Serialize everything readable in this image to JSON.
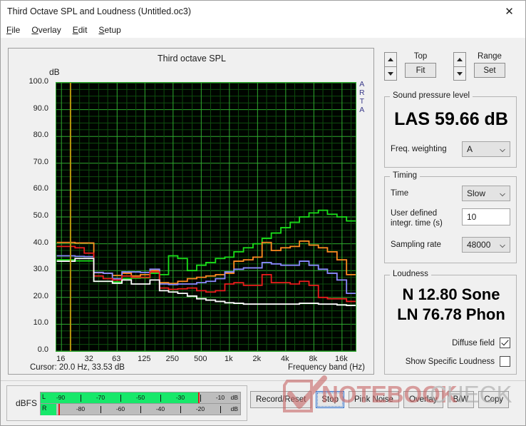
{
  "window": {
    "title": "Third Octave SPL and Loudness (Untitled.oc3)",
    "close_icon": "close-icon"
  },
  "menubar": {
    "items": [
      {
        "label": "File",
        "accel": "F"
      },
      {
        "label": "Overlay",
        "accel": "O"
      },
      {
        "label": "Edit",
        "accel": "E"
      },
      {
        "label": "Setup",
        "accel": "S"
      }
    ]
  },
  "graph": {
    "title": "Third octave SPL",
    "y_unit": "dB",
    "watermark_label": "ARTA",
    "cursor_text": "Cursor:   20.0 Hz, 33.53 dB",
    "x_axis_title": "Frequency band (Hz)"
  },
  "chart_data": {
    "type": "line",
    "title": "Third octave SPL",
    "xlabel": "Frequency band (Hz)",
    "ylabel": "dB",
    "ylim": [
      0,
      100
    ],
    "ytick_labels": [
      "100.0",
      "90.0",
      "80.0",
      "70.0",
      "60.0",
      "50.0",
      "40.0",
      "30.0",
      "20.0",
      "10.0",
      "0.0"
    ],
    "ytick_values": [
      100,
      90,
      80,
      70,
      60,
      50,
      40,
      30,
      20,
      10,
      0
    ],
    "xtick_labels": [
      "16",
      "32",
      "63",
      "125",
      "250",
      "500",
      "1k",
      "2k",
      "4k",
      "8k",
      "16k"
    ],
    "xtick_values": [
      16,
      32,
      63,
      125,
      250,
      500,
      1000,
      2000,
      4000,
      8000,
      16000
    ],
    "grid": true,
    "grid_color": "#1d7a1d",
    "grid_major_color": "#2faa2f",
    "background": "#000500",
    "cursor_line": {
      "x_hz": 20.0,
      "y_db": 33.53,
      "color": "#b8960c"
    },
    "bands_hz": [
      16,
      20,
      25,
      31.5,
      40,
      50,
      63,
      80,
      100,
      125,
      160,
      200,
      250,
      315,
      400,
      500,
      630,
      800,
      1000,
      1250,
      1600,
      2000,
      2500,
      3150,
      4000,
      5000,
      6300,
      8000,
      10000,
      12500,
      16000,
      20000
    ],
    "series": [
      {
        "name": "green",
        "color": "#19e019",
        "values": [
          34.0,
          34.0,
          33.6,
          33.6,
          26.0,
          26.0,
          25.8,
          27.0,
          27.2,
          27.3,
          29.0,
          28.5,
          35.5,
          34.5,
          30.0,
          32.0,
          33.0,
          34.5,
          35.0,
          37.0,
          38.5,
          40.0,
          42.0,
          44.0,
          46.0,
          48.0,
          50.0,
          51.5,
          52.5,
          51.0,
          50.0,
          48.5
        ]
      },
      {
        "name": "orange",
        "color": "#ff8c21",
        "values": [
          40.5,
          40.5,
          40.3,
          40.3,
          29.2,
          29.0,
          28.2,
          29.0,
          28.0,
          28.5,
          30.0,
          25.5,
          25.2,
          26.0,
          27.0,
          27.5,
          28.0,
          28.5,
          29.0,
          33.5,
          34.0,
          35.0,
          40.5,
          37.5,
          38.5,
          39.0,
          41.0,
          39.5,
          38.5,
          37.0,
          34.0,
          28.5
        ]
      },
      {
        "name": "blue",
        "color": "#8a8aff",
        "values": [
          35.5,
          35.5,
          35.3,
          35.2,
          29.3,
          29.0,
          27.0,
          29.5,
          29.5,
          29.3,
          30.5,
          25.0,
          24.8,
          25.0,
          25.0,
          25.5,
          26.0,
          27.0,
          29.5,
          30.5,
          31.0,
          31.0,
          33.0,
          32.5,
          32.0,
          32.0,
          33.5,
          32.0,
          30.5,
          29.0,
          26.5,
          21.5
        ]
      },
      {
        "name": "red",
        "color": "#ec1c1c",
        "values": [
          39.0,
          39.0,
          38.5,
          36.5,
          28.0,
          27.0,
          26.5,
          28.0,
          27.5,
          27.5,
          29.5,
          23.5,
          23.0,
          23.2,
          23.5,
          22.5,
          22.0,
          22.5,
          25.0,
          25.5,
          24.5,
          24.5,
          28.5,
          25.5,
          25.5,
          25.0,
          26.0,
          24.5,
          20.0,
          19.5,
          19.5,
          18.5
        ]
      },
      {
        "name": "white",
        "color": "#ffffff",
        "values": [
          33.5,
          33.5,
          34.5,
          34.5,
          26.0,
          26.0,
          25.3,
          26.5,
          25.0,
          25.0,
          26.5,
          22.5,
          22.0,
          21.5,
          20.5,
          19.5,
          19.0,
          18.5,
          18.0,
          17.8,
          17.5,
          17.5,
          17.5,
          17.5,
          17.5,
          17.5,
          17.8,
          17.8,
          17.5,
          17.5,
          17.2,
          17.0
        ]
      }
    ]
  },
  "controls": {
    "top": {
      "label": "Top",
      "button": "Fit"
    },
    "range": {
      "label": "Range",
      "button": "Set"
    },
    "spl": {
      "legend": "Sound pressure level",
      "value": "LAS 59.66 dB",
      "weighting_label": "Freq. weighting",
      "weighting_value": "A"
    },
    "timing": {
      "legend": "Timing",
      "time_label": "Time",
      "time_value": "Slow",
      "integr_label_line1": "User defined",
      "integr_label_line2": "integr. time (s)",
      "integr_value": "10",
      "sampling_label": "Sampling rate",
      "sampling_value": "48000"
    },
    "loudness": {
      "legend": "Loudness",
      "value_sone": "N 12.80 Sone",
      "value_phon": "LN 76.78 Phon",
      "diffuse_field_label": "Diffuse field",
      "diffuse_field_checked": true,
      "specific_loudness_label": "Show Specific Loudness",
      "specific_loudness_checked": false
    }
  },
  "meter": {
    "unit_label": "dBFS",
    "left": {
      "channel": "L",
      "unit": "dB",
      "fill_percent": 79,
      "peak_percent": 79,
      "ticks": [
        "-90",
        "-70",
        "-50",
        "-30",
        "-10"
      ]
    },
    "right": {
      "channel": "R",
      "unit": "dB",
      "fill_percent": 8,
      "peak_percent": 9,
      "ticks": [
        "-80",
        "-60",
        "-40",
        "-20"
      ]
    }
  },
  "buttons": [
    {
      "label": "Record/Reset",
      "focused": false
    },
    {
      "label": "Stop",
      "focused": true
    },
    {
      "label": "Pink Noise",
      "focused": false
    },
    {
      "label": "Overlay",
      "focused": false
    },
    {
      "label": "B/W",
      "focused": false
    },
    {
      "label": "Copy",
      "focused": false
    }
  ],
  "watermark": {
    "text_bold": "NOTEBOOK",
    "text_light": "CHECK"
  }
}
